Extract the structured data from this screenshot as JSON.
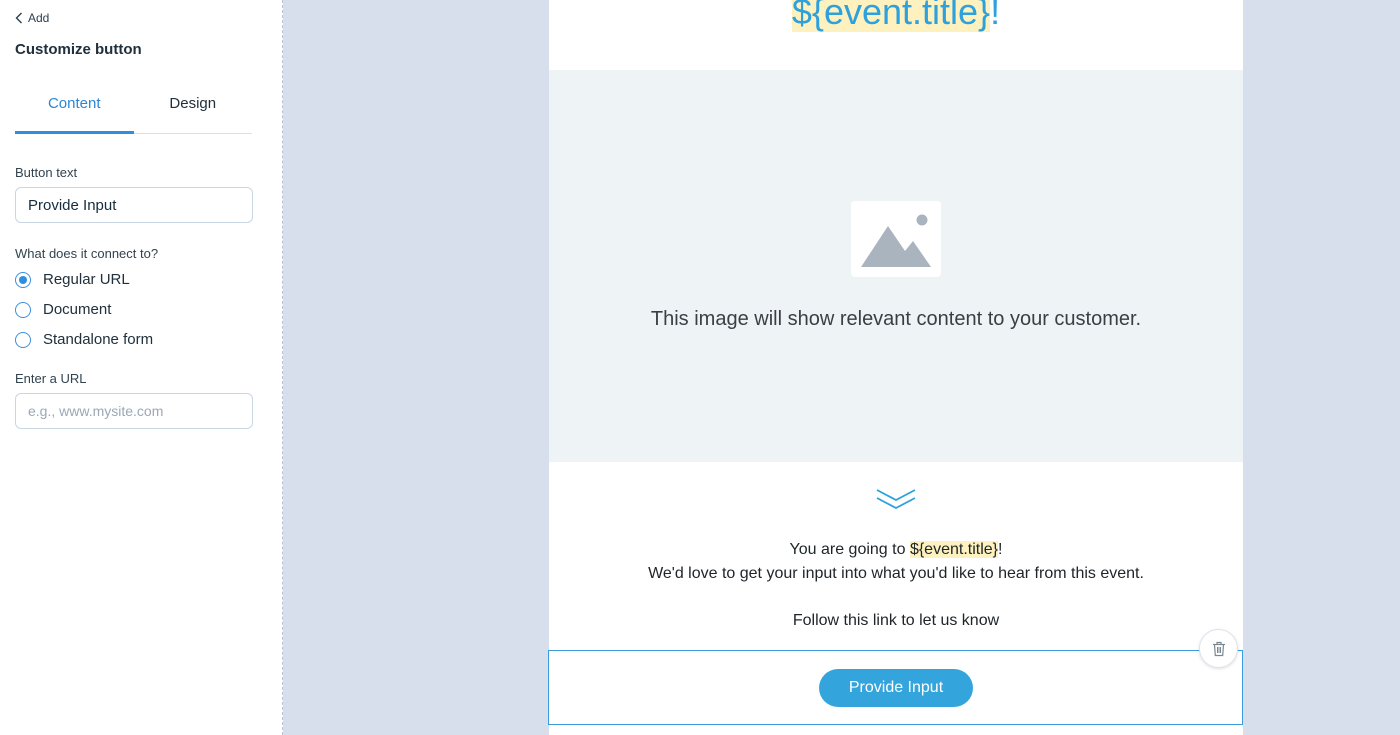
{
  "panel": {
    "back_label": "Add",
    "title": "Customize button",
    "tabs": [
      {
        "label": "Content",
        "active": true
      },
      {
        "label": "Design",
        "active": false
      }
    ],
    "button_text_label": "Button text",
    "button_text_value": "Provide Input",
    "connect_label": "What does it connect to?",
    "connect_options": [
      {
        "label": "Regular URL",
        "checked": true
      },
      {
        "label": "Document",
        "checked": false
      },
      {
        "label": "Standalone form",
        "checked": false
      }
    ],
    "url_label": "Enter a URL",
    "url_placeholder": "e.g., www.mysite.com",
    "url_value": ""
  },
  "email": {
    "title_var": "${event.title}",
    "title_suffix": "!",
    "image_placeholder_text": "This image will show relevant content to your customer.",
    "line1_prefix": "You are going to ",
    "line1_var": "${event.title}",
    "line1_suffix": "!",
    "line2": "We'd love to get your input into what you'd like to hear from this event.",
    "line3": "Follow this link to let us know",
    "cta_label": "Provide Input"
  },
  "icons": {
    "back": "chevron-left-icon",
    "image": "image-placeholder-icon",
    "divider": "double-chevron-down-icon",
    "delete": "trash-icon"
  },
  "colors": {
    "accent": "#2e8fe0",
    "canvas_bg": "#d8dfec",
    "title_text": "#2ea1dc",
    "highlight": "#fdf1bf",
    "cta_bg": "#34a5dc",
    "image_bg": "#eef3f6"
  }
}
